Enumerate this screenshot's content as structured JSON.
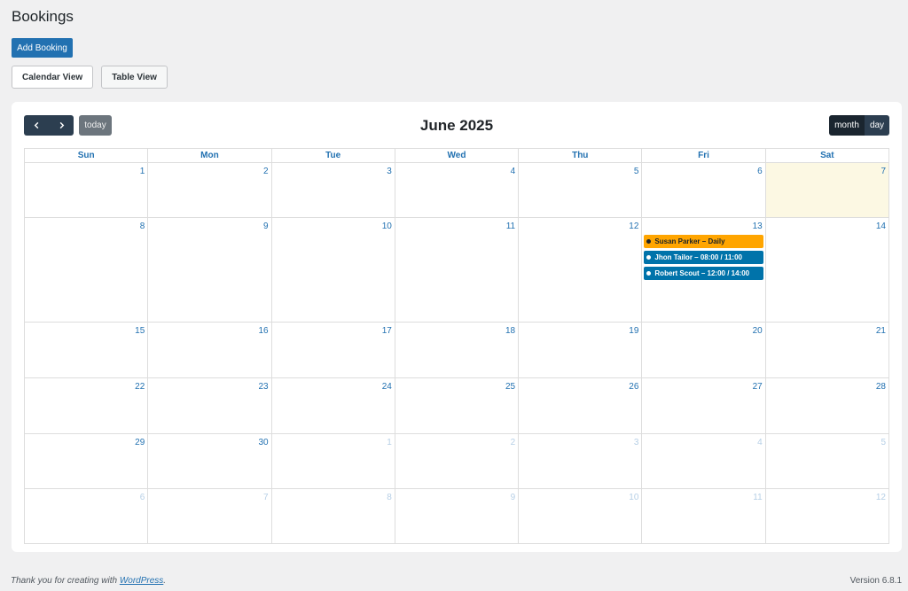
{
  "page": {
    "title": "Bookings"
  },
  "actions": {
    "add_booking": "Add Booking"
  },
  "view_tabs": {
    "calendar": "Calendar View",
    "table": "Table View",
    "active": "calendar"
  },
  "calendar": {
    "title": "June 2025",
    "today_label": "today",
    "view_buttons": {
      "month": "month",
      "day": "day",
      "active": "month"
    },
    "day_headers": [
      "Sun",
      "Mon",
      "Tue",
      "Wed",
      "Thu",
      "Fri",
      "Sat"
    ],
    "weeks": [
      [
        {
          "d": "1"
        },
        {
          "d": "2"
        },
        {
          "d": "3"
        },
        {
          "d": "4"
        },
        {
          "d": "5"
        },
        {
          "d": "6"
        },
        {
          "d": "7",
          "today": true
        }
      ],
      [
        {
          "d": "8"
        },
        {
          "d": "9"
        },
        {
          "d": "10"
        },
        {
          "d": "11"
        },
        {
          "d": "12"
        },
        {
          "d": "13",
          "events": [
            {
              "label": "Susan Parker – Daily",
              "bg": "#ffa500",
              "text": "#1d2327",
              "dot": "#1d2327"
            },
            {
              "label": "Jhon Tailor – 08:00 / 11:00",
              "bg": "#0073aa",
              "text": "#ffffff",
              "dot": "#ffffff"
            },
            {
              "label": "Robert Scout – 12:00 / 14:00",
              "bg": "#0073aa",
              "text": "#ffffff",
              "dot": "#ffffff"
            }
          ]
        },
        {
          "d": "14"
        }
      ],
      [
        {
          "d": "15"
        },
        {
          "d": "16"
        },
        {
          "d": "17"
        },
        {
          "d": "18"
        },
        {
          "d": "19"
        },
        {
          "d": "20"
        },
        {
          "d": "21"
        }
      ],
      [
        {
          "d": "22"
        },
        {
          "d": "23"
        },
        {
          "d": "24"
        },
        {
          "d": "25"
        },
        {
          "d": "26"
        },
        {
          "d": "27"
        },
        {
          "d": "28"
        }
      ],
      [
        {
          "d": "29"
        },
        {
          "d": "30"
        },
        {
          "d": "1",
          "other": true
        },
        {
          "d": "2",
          "other": true
        },
        {
          "d": "3",
          "other": true
        },
        {
          "d": "4",
          "other": true
        },
        {
          "d": "5",
          "other": true
        }
      ],
      [
        {
          "d": "6",
          "other": true
        },
        {
          "d": "7",
          "other": true
        },
        {
          "d": "8",
          "other": true
        },
        {
          "d": "9",
          "other": true
        },
        {
          "d": "10",
          "other": true
        },
        {
          "d": "11",
          "other": true
        },
        {
          "d": "12",
          "other": true
        }
      ]
    ]
  },
  "icons": {
    "prev": "chevron-left-icon",
    "next": "chevron-right-icon"
  },
  "colors": {
    "primary": "#2271b1",
    "nav_dark": "#2c3e50",
    "today_bg": "#fcf8e3"
  },
  "footer": {
    "thanks_prefix": "Thank you for creating with ",
    "thanks_link": "WordPress",
    "thanks_suffix": ".",
    "version": "Version 6.8.1"
  }
}
